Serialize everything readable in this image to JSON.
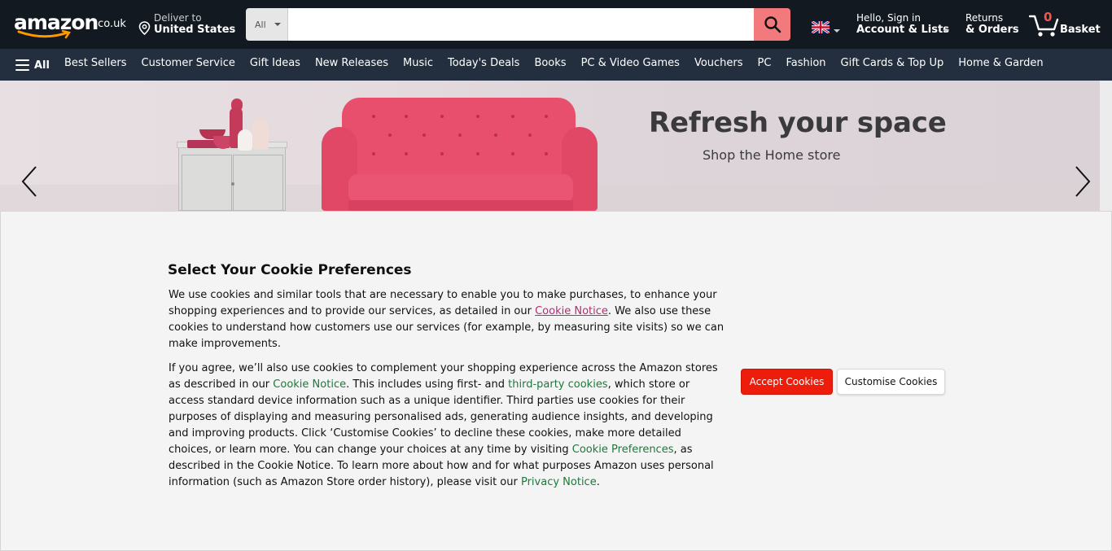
{
  "header": {
    "logo_word": "amazon",
    "logo_tld": ".co.uk",
    "deliver_line1": "Deliver to",
    "deliver_line2": "United States",
    "search_category": "All",
    "search_placeholder": "",
    "account_line1": "Hello, Sign in",
    "account_line2": "Account & Lists",
    "returns_line1": "Returns",
    "returns_line2": "& Orders",
    "basket_count": "0",
    "basket_label": "Basket"
  },
  "subnav": {
    "all_label": "All",
    "links": [
      "Best Sellers",
      "Customer Service",
      "Gift Ideas",
      "New Releases",
      "Music",
      "Today's Deals",
      "Books",
      "PC & Video Games",
      "Vouchers",
      "PC",
      "Fashion",
      "Gift Cards & Top Up",
      "Home & Garden"
    ]
  },
  "hero": {
    "title": "Refresh your space",
    "subtitle": "Shop the Home store"
  },
  "cookie": {
    "title": "Select Your Cookie Preferences",
    "p1_a": "We use cookies and similar tools that are necessary to enable you to make purchases, to enhance your shopping experiences and to provide our services, as detailed in our ",
    "p1_link": "Cookie Notice",
    "p1_b": ". We also use these cookies to understand how customers use our services (for example, by measuring site visits) so we can make improvements.",
    "p2_a": "If you agree, we’ll also use cookies to complement your shopping experience across the Amazon stores as described in our ",
    "p2_link1": "Cookie Notice",
    "p2_b": ". This includes using first- and ",
    "p2_link2": "third-party cookies",
    "p2_c": ", which store or access standard device information such as a unique identifier. Third parties use cookies for their purposes of displaying and measuring personalised ads, generating audience insights, and developing and improving products. Click ‘Customise Cookies’ to decline these cookies, make more detailed choices, or learn more. You can change your choices at any time by visiting ",
    "p2_link3": "Cookie Preferences",
    "p2_d": ", as described in the Cookie Notice. To learn more about how and for what purposes Amazon uses personal information (such as Amazon Store order history), please visit our ",
    "p2_link4": "Privacy Notice",
    "p2_e": ".",
    "accept_label": "Accept Cookies",
    "customise_label": "Customise Cookies"
  },
  "colors": {
    "header_bg": "#131921",
    "subnav_bg": "#232f3e",
    "accept_button": "#ee1d0b",
    "link_green": "#1b7a3a",
    "link_pink": "#b12e74"
  },
  "icons": {
    "search": "magnifier-icon",
    "location": "location-pin-icon",
    "basket": "cart-icon",
    "flag": "uk-flag-icon",
    "menu": "hamburger-icon",
    "prev": "chevron-left-icon",
    "next": "chevron-right-icon"
  }
}
